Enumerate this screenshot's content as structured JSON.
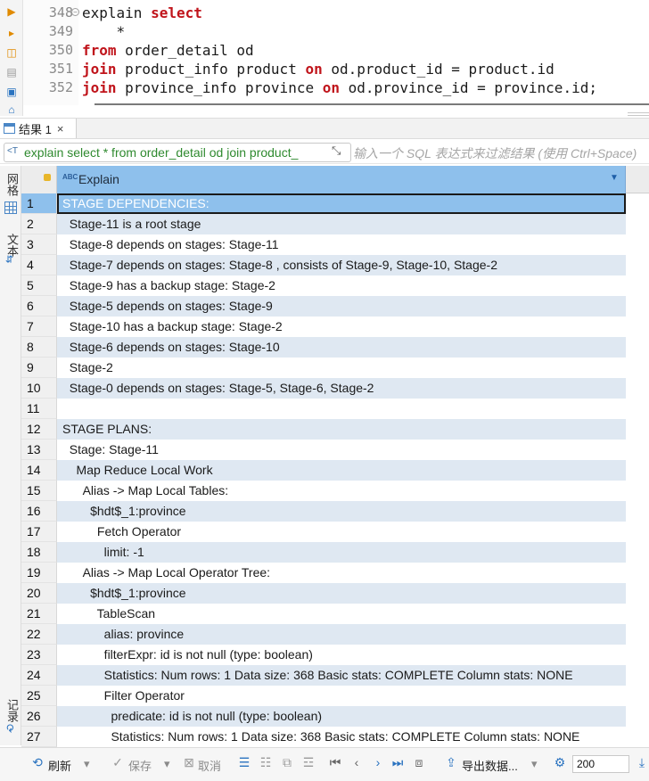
{
  "editor": {
    "line_numbers": [
      "348",
      "349",
      "350",
      "351",
      "352"
    ],
    "code_lines": [
      [
        {
          "t": "explain ",
          "k": false
        },
        {
          "t": "select",
          "k": true
        }
      ],
      [
        {
          "t": "    *",
          "k": false
        }
      ],
      [
        {
          "t": "from",
          "k": true
        },
        {
          "t": " order_detail od",
          "k": false
        }
      ],
      [
        {
          "t": "join",
          "k": true
        },
        {
          "t": " product_info product ",
          "k": false
        },
        {
          "t": "on",
          "k": true
        },
        {
          "t": " od.product_id = product.id",
          "k": false
        }
      ],
      [
        {
          "t": "join",
          "k": true
        },
        {
          "t": " province_info province ",
          "k": false
        },
        {
          "t": "on",
          "k": true
        },
        {
          "t": " od.province_id = province.id;",
          "k": false
        }
      ]
    ]
  },
  "results_tab": {
    "label": "结果 1",
    "close": "×"
  },
  "filter": {
    "query": "explain select * from order_detail od join product_",
    "placeholder": "输入一个 SQL 表达式来过滤结果 (使用 Ctrl+Space)"
  },
  "side_tabs": {
    "grid": "网格",
    "text": "文本",
    "record": "记录"
  },
  "grid": {
    "column": "Explain",
    "rows": [
      "STAGE DEPENDENCIES:",
      "  Stage-11 is a root stage",
      "  Stage-8 depends on stages: Stage-11",
      "  Stage-7 depends on stages: Stage-8 , consists of Stage-9, Stage-10, Stage-2",
      "  Stage-9 has a backup stage: Stage-2",
      "  Stage-5 depends on stages: Stage-9",
      "  Stage-10 has a backup stage: Stage-2",
      "  Stage-6 depends on stages: Stage-10",
      "  Stage-2",
      "  Stage-0 depends on stages: Stage-5, Stage-6, Stage-2",
      "",
      "STAGE PLANS:",
      "  Stage: Stage-11",
      "    Map Reduce Local Work",
      "      Alias -> Map Local Tables:",
      "        $hdt$_1:province",
      "          Fetch Operator",
      "            limit: -1",
      "      Alias -> Map Local Operator Tree:",
      "        $hdt$_1:province",
      "          TableScan",
      "            alias: province",
      "            filterExpr: id is not null (type: boolean)",
      "            Statistics: Num rows: 1 Data size: 368 Basic stats: COMPLETE Column stats: NONE",
      "            Filter Operator",
      "              predicate: id is not null (type: boolean)",
      "              Statistics: Num rows: 1 Data size: 368 Basic stats: COMPLETE Column stats: NONE"
    ],
    "selected_row": 1
  },
  "toolbar": {
    "refresh": "刷新",
    "save": "保存",
    "cancel": "取消",
    "export": "导出数据...",
    "page_size": "200"
  },
  "colors": {
    "keyword": "#c0141b",
    "header_blue": "#8ec0ec",
    "alt_row": "#dfe8f2",
    "filter_text": "#2f8a2f"
  }
}
